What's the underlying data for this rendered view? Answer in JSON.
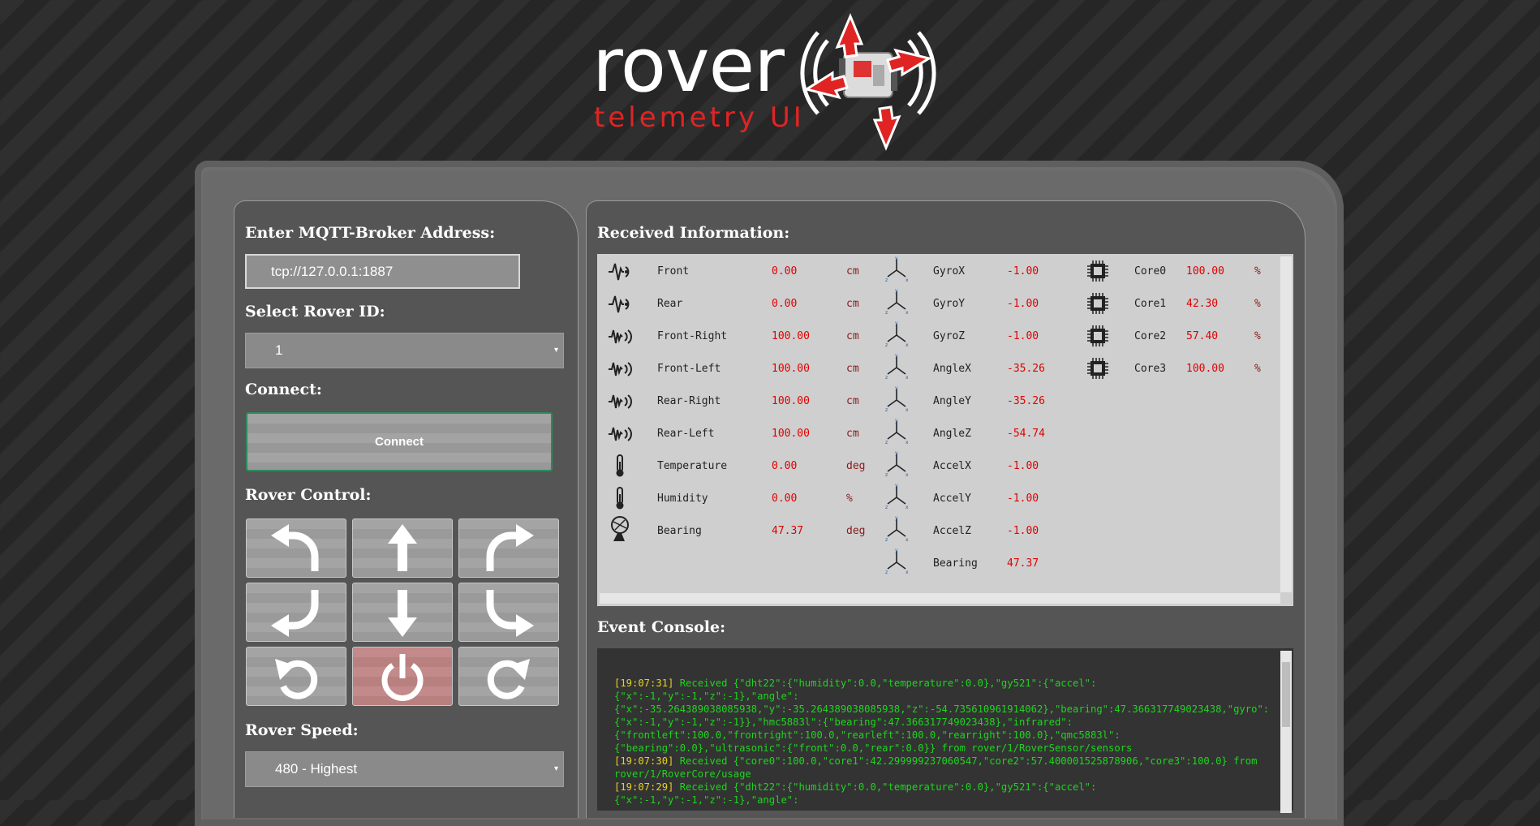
{
  "logo": {
    "word": "rover",
    "sub": "telemetry UI"
  },
  "left": {
    "broker_heading": "Enter MQTT-Broker Address:",
    "broker_value": "tcp://127.0.0.1:1887",
    "rover_id_heading": "Select Rover ID:",
    "rover_id_value": "1",
    "connect_heading": "Connect:",
    "connect_label": "Connect",
    "control_heading": "Rover Control:",
    "speed_heading": "Rover Speed:",
    "speed_value": "480 - Highest",
    "caret": "▾",
    "controls": [
      "turn-left-forward",
      "forward",
      "turn-right-forward",
      "turn-left-backward",
      "backward",
      "turn-right-backward",
      "rotate-left",
      "power",
      "rotate-right"
    ]
  },
  "right": {
    "received_heading": "Received Information:",
    "console_heading": "Event Console:"
  },
  "sensors": [
    {
      "label": "Front",
      "value": "0.00",
      "unit": "cm",
      "icon": "ultrasonic-icon"
    },
    {
      "label": "Rear",
      "value": "0.00",
      "unit": "cm",
      "icon": "ultrasonic-icon"
    },
    {
      "label": "Front-Right",
      "value": "100.00",
      "unit": "cm",
      "icon": "infrared-icon"
    },
    {
      "label": "Front-Left",
      "value": "100.00",
      "unit": "cm",
      "icon": "infrared-icon"
    },
    {
      "label": "Rear-Right",
      "value": "100.00",
      "unit": "cm",
      "icon": "infrared-icon"
    },
    {
      "label": "Rear-Left",
      "value": "100.00",
      "unit": "cm",
      "icon": "infrared-icon"
    },
    {
      "label": "Temperature",
      "value": "0.00",
      "unit": "deg",
      "icon": "thermometer-icon"
    },
    {
      "label": "Humidity",
      "value": "0.00",
      "unit": "%",
      "icon": "thermometer-icon"
    },
    {
      "label": "Bearing",
      "value": "47.37",
      "unit": "deg",
      "icon": "compass-icon"
    }
  ],
  "gyro": [
    {
      "label": "GyroX",
      "value": "-1.00"
    },
    {
      "label": "GyroY",
      "value": "-1.00"
    },
    {
      "label": "GyroZ",
      "value": "-1.00"
    },
    {
      "label": "AngleX",
      "value": "-35.26"
    },
    {
      "label": "AngleY",
      "value": "-35.26"
    },
    {
      "label": "AngleZ",
      "value": "-54.74"
    },
    {
      "label": "AccelX",
      "value": "-1.00"
    },
    {
      "label": "AccelY",
      "value": "-1.00"
    },
    {
      "label": "AccelZ",
      "value": "-1.00"
    },
    {
      "label": "Bearing",
      "value": "47.37"
    }
  ],
  "axes_labels": {
    "x": "x",
    "y": "y",
    "z": "z"
  },
  "cores": [
    {
      "label": "Core0",
      "value": "100.00",
      "unit": "%"
    },
    {
      "label": "Core1",
      "value": "42.30",
      "unit": "%"
    },
    {
      "label": "Core2",
      "value": "57.40",
      "unit": "%"
    },
    {
      "label": "Core3",
      "value": "100.00",
      "unit": "%"
    }
  ],
  "console": [
    {
      "ts": "[19:07:31]",
      "text": " Received {\"dht22\":{\"humidity\":0.0,\"temperature\":0.0},\"gy521\":{\"accel\":"
    },
    {
      "ts": "",
      "text": "{\"x\":-1,\"y\":-1,\"z\":-1},\"angle\":"
    },
    {
      "ts": "",
      "text": "{\"x\":-35.264389038085938,\"y\":-35.264389038085938,\"z\":-54.735610961914062},\"bearing\":47.366317749023438,\"gyro\":"
    },
    {
      "ts": "",
      "text": "{\"x\":-1,\"y\":-1,\"z\":-1}},\"hmc5883l\":{\"bearing\":47.366317749023438},\"infrared\":"
    },
    {
      "ts": "",
      "text": "{\"frontleft\":100.0,\"frontright\":100.0,\"rearleft\":100.0,\"rearright\":100.0},\"qmc5883l\":"
    },
    {
      "ts": "",
      "text": "{\"bearing\":0.0},\"ultrasonic\":{\"front\":0.0,\"rear\":0.0}} from rover/1/RoverSensor/sensors"
    },
    {
      "ts": "[19:07:30]",
      "text": " Received {\"core0\":100.0,\"core1\":42.299999237060547,\"core2\":57.400001525878906,\"core3\":100.0} from"
    },
    {
      "ts": "",
      "text": "rover/1/RoverCore/usage"
    },
    {
      "ts": "[19:07:29]",
      "text": " Received {\"dht22\":{\"humidity\":0.0,\"temperature\":0.0},\"gy521\":{\"accel\":"
    },
    {
      "ts": "",
      "text": "{\"x\":-1,\"y\":-1,\"z\":-1},\"angle\":"
    }
  ],
  "colors": {
    "value_red": "#e00000",
    "console_green": "#1fd41f",
    "console_timestamp": "#e8d21e",
    "connect_border": "#2e8a5c"
  }
}
